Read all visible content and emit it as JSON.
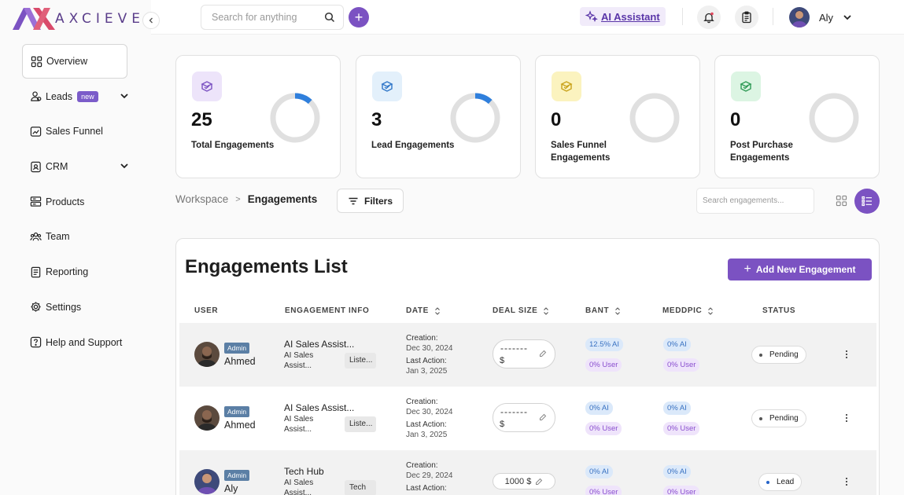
{
  "brand": {
    "name": "AXCIEVE",
    "mark_colors": [
      "#7b52c2",
      "#d94a6b"
    ]
  },
  "sidebar": {
    "collapse_icon": "chevron-left-icon",
    "items": [
      {
        "label": "Overview",
        "icon": "grid-icon",
        "active": true
      },
      {
        "label": "Leads",
        "icon": "people-icon",
        "badge": "new",
        "expandable": true
      },
      {
        "label": "Sales Funnel",
        "icon": "funnel-icon"
      },
      {
        "label": "CRM",
        "icon": "crm-icon",
        "expandable": true
      },
      {
        "label": "Products",
        "icon": "server-icon"
      },
      {
        "label": "Team",
        "icon": "team-icon"
      },
      {
        "label": "Reporting",
        "icon": "report-icon"
      },
      {
        "label": "Settings",
        "icon": "gear-icon"
      },
      {
        "label": "Help and Support",
        "icon": "help-icon"
      }
    ]
  },
  "topbar": {
    "search_placeholder": "Search for anything",
    "ai_assistant_label": "AI Assistant",
    "user_name": "Aly"
  },
  "stats": [
    {
      "value": "25",
      "label": "Total Engagements",
      "icon_bg": "#ede4fa",
      "icon_color": "#7b52c2",
      "fraction": 0.12
    },
    {
      "value": "3",
      "label": "Lead Engagements",
      "icon_bg": "#e3f0fb",
      "icon_color": "#2f76c8",
      "fraction": 0.12
    },
    {
      "value": "0",
      "label": "Sales Funnel Engagements",
      "icon_bg": "#fbf3bf",
      "icon_color": "#c9a21a",
      "fraction": 0
    },
    {
      "value": "0",
      "label": "Post Purchase Engagements",
      "icon_bg": "#dcf5e3",
      "icon_color": "#2f9a55",
      "fraction": 0
    }
  ],
  "breadcrumb": {
    "root": "Workspace",
    "current": "Engagements"
  },
  "filters_label": "Filters",
  "engagement_search_placeholder": "Search engagements...",
  "list": {
    "title": "Engagements List",
    "add_label": "Add New Engagement",
    "columns": [
      "USER",
      "ENGAGEMENT INFO",
      "DATE",
      "DEAL SIZE",
      "BANT",
      "MEDDPIC",
      "STATUS"
    ],
    "rows": [
      {
        "role": "Admin",
        "user": "Ahmed",
        "title": "AI Sales Assist...",
        "sub": "AI Sales Assist...",
        "chip": "Liste...",
        "creation_label": "Creation:",
        "creation": "Dec 30, 2024",
        "last_label": "Last Action:",
        "last": "Jan 3, 2025",
        "deal_dash": "-------",
        "deal_cur": "$",
        "deal_amount": "",
        "bant_ai": "12.5% AI",
        "bant_user": "0% User",
        "med_ai": "0% AI",
        "med_user": "0% User",
        "status": "Pending"
      },
      {
        "role": "Admin",
        "user": "Ahmed",
        "title": "AI Sales Assist...",
        "sub": "AI Sales Assist...",
        "chip": "Liste...",
        "creation_label": "Creation:",
        "creation": "Dec 30, 2024",
        "last_label": "Last Action:",
        "last": "Jan 3, 2025",
        "deal_dash": "-------",
        "deal_cur": "$",
        "deal_amount": "",
        "bant_ai": "0% AI",
        "bant_user": "0% User",
        "med_ai": "0% AI",
        "med_user": "0% User",
        "status": "Pending"
      },
      {
        "role": "Admin",
        "user": "Aly",
        "title": "Tech Hub",
        "sub": "AI Sales Assist...",
        "chip": "Tech",
        "creation_label": "Creation:",
        "creation": "Dec 29, 2024",
        "last_label": "Last Action:",
        "last": "",
        "deal_dash": "",
        "deal_cur": "",
        "deal_amount": "1000 $",
        "bant_ai": "0% AI",
        "bant_user": "0% User",
        "med_ai": "0% AI",
        "med_user": "0% User",
        "status": "Lead"
      }
    ]
  }
}
